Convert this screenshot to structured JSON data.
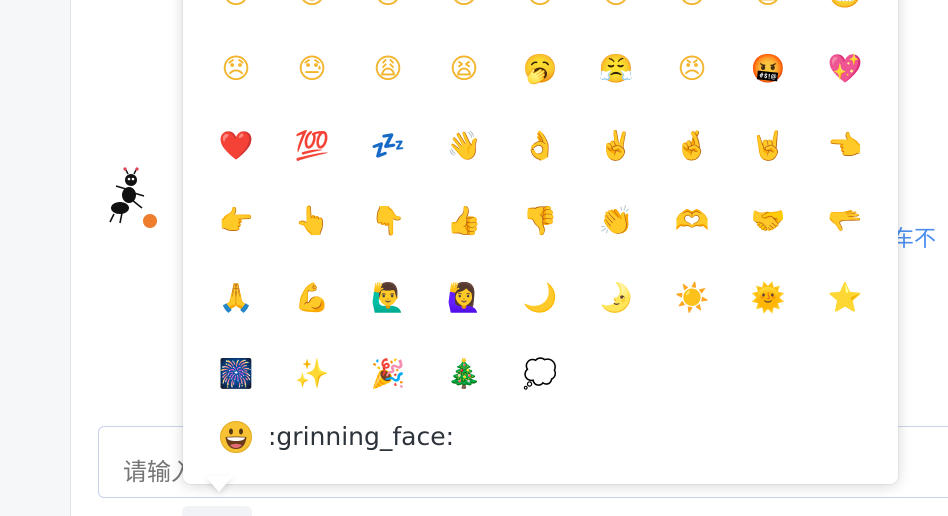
{
  "background": {
    "right_text": "车不"
  },
  "input": {
    "placeholder": "请输入"
  },
  "emoji_picker": {
    "rows": [
      [
        "😞",
        "😓",
        "😩",
        "😫",
        "🥱",
        "😤",
        "😠",
        "🤬",
        "💖"
      ],
      [
        "❤️",
        "💯",
        "💤",
        "👋",
        "👌",
        "✌️",
        "🤞",
        "🤘",
        "👈"
      ],
      [
        "👉",
        "👆",
        "👇",
        "👍",
        "👎",
        "👏",
        "🫶",
        "🤝",
        "🫳"
      ],
      [
        "🙏",
        "💪",
        "🙋‍♂️",
        "🙋‍♀️",
        "🌙",
        "🌛",
        "☀️",
        "🌞",
        "⭐"
      ],
      [
        "🎆",
        "✨",
        "🎉",
        "🎄",
        "💭"
      ]
    ],
    "top_row_partial": [
      "😢",
      "😊",
      "😭",
      "😭",
      "😢",
      "😢",
      "😭",
      "🙀",
      "😬"
    ],
    "preview": {
      "emoji_name": ":grinning_face:"
    }
  },
  "colors": {
    "accent_blue": "#4c8ef0",
    "emoji_yellow": "#f2b52d",
    "border": "#c8d3ea"
  }
}
